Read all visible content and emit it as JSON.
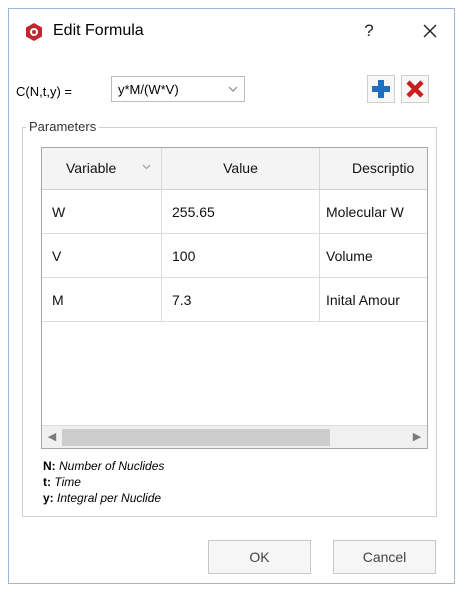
{
  "window": {
    "title": "Edit Formula",
    "help_label": "?",
    "app_icon": "app-logo-icon",
    "close_icon": "close-icon"
  },
  "formula": {
    "label": "C(N,t,y) =",
    "value": "y*M/(W*V)",
    "add_icon": "plus-icon",
    "remove_icon": "x-icon",
    "add_color": "#1e6fc1",
    "remove_color": "#c81e1e"
  },
  "parameters": {
    "group_title": "Parameters",
    "columns": [
      "Variable",
      "Value",
      "Descriptio"
    ],
    "rows": [
      {
        "variable": "W",
        "value": "255.65",
        "description": "Molecular W"
      },
      {
        "variable": "V",
        "value": "100",
        "description": "Volume"
      },
      {
        "variable": "M",
        "value": "7.3",
        "description": "Inital Amour"
      }
    ],
    "scroll_left": "◀",
    "scroll_right": "▶"
  },
  "legend": [
    {
      "key": "N:",
      "desc": "Number of Nuclides"
    },
    {
      "key": "t:",
      "desc": "Time"
    },
    {
      "key": "y:",
      "desc": "Integral per Nuclide"
    }
  ],
  "buttons": {
    "ok": "OK",
    "cancel": "Cancel"
  }
}
